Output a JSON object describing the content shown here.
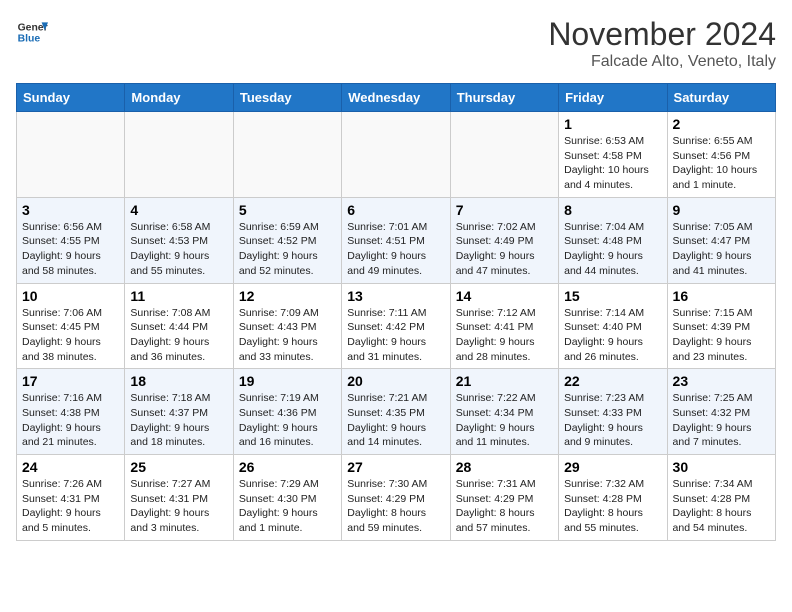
{
  "header": {
    "logo_line1": "General",
    "logo_line2": "Blue",
    "month": "November 2024",
    "location": "Falcade Alto, Veneto, Italy"
  },
  "weekdays": [
    "Sunday",
    "Monday",
    "Tuesday",
    "Wednesday",
    "Thursday",
    "Friday",
    "Saturday"
  ],
  "weeks": [
    [
      {
        "day": "",
        "info": ""
      },
      {
        "day": "",
        "info": ""
      },
      {
        "day": "",
        "info": ""
      },
      {
        "day": "",
        "info": ""
      },
      {
        "day": "",
        "info": ""
      },
      {
        "day": "1",
        "info": "Sunrise: 6:53 AM\nSunset: 4:58 PM\nDaylight: 10 hours\nand 4 minutes."
      },
      {
        "day": "2",
        "info": "Sunrise: 6:55 AM\nSunset: 4:56 PM\nDaylight: 10 hours\nand 1 minute."
      }
    ],
    [
      {
        "day": "3",
        "info": "Sunrise: 6:56 AM\nSunset: 4:55 PM\nDaylight: 9 hours\nand 58 minutes."
      },
      {
        "day": "4",
        "info": "Sunrise: 6:58 AM\nSunset: 4:53 PM\nDaylight: 9 hours\nand 55 minutes."
      },
      {
        "day": "5",
        "info": "Sunrise: 6:59 AM\nSunset: 4:52 PM\nDaylight: 9 hours\nand 52 minutes."
      },
      {
        "day": "6",
        "info": "Sunrise: 7:01 AM\nSunset: 4:51 PM\nDaylight: 9 hours\nand 49 minutes."
      },
      {
        "day": "7",
        "info": "Sunrise: 7:02 AM\nSunset: 4:49 PM\nDaylight: 9 hours\nand 47 minutes."
      },
      {
        "day": "8",
        "info": "Sunrise: 7:04 AM\nSunset: 4:48 PM\nDaylight: 9 hours\nand 44 minutes."
      },
      {
        "day": "9",
        "info": "Sunrise: 7:05 AM\nSunset: 4:47 PM\nDaylight: 9 hours\nand 41 minutes."
      }
    ],
    [
      {
        "day": "10",
        "info": "Sunrise: 7:06 AM\nSunset: 4:45 PM\nDaylight: 9 hours\nand 38 minutes."
      },
      {
        "day": "11",
        "info": "Sunrise: 7:08 AM\nSunset: 4:44 PM\nDaylight: 9 hours\nand 36 minutes."
      },
      {
        "day": "12",
        "info": "Sunrise: 7:09 AM\nSunset: 4:43 PM\nDaylight: 9 hours\nand 33 minutes."
      },
      {
        "day": "13",
        "info": "Sunrise: 7:11 AM\nSunset: 4:42 PM\nDaylight: 9 hours\nand 31 minutes."
      },
      {
        "day": "14",
        "info": "Sunrise: 7:12 AM\nSunset: 4:41 PM\nDaylight: 9 hours\nand 28 minutes."
      },
      {
        "day": "15",
        "info": "Sunrise: 7:14 AM\nSunset: 4:40 PM\nDaylight: 9 hours\nand 26 minutes."
      },
      {
        "day": "16",
        "info": "Sunrise: 7:15 AM\nSunset: 4:39 PM\nDaylight: 9 hours\nand 23 minutes."
      }
    ],
    [
      {
        "day": "17",
        "info": "Sunrise: 7:16 AM\nSunset: 4:38 PM\nDaylight: 9 hours\nand 21 minutes."
      },
      {
        "day": "18",
        "info": "Sunrise: 7:18 AM\nSunset: 4:37 PM\nDaylight: 9 hours\nand 18 minutes."
      },
      {
        "day": "19",
        "info": "Sunrise: 7:19 AM\nSunset: 4:36 PM\nDaylight: 9 hours\nand 16 minutes."
      },
      {
        "day": "20",
        "info": "Sunrise: 7:21 AM\nSunset: 4:35 PM\nDaylight: 9 hours\nand 14 minutes."
      },
      {
        "day": "21",
        "info": "Sunrise: 7:22 AM\nSunset: 4:34 PM\nDaylight: 9 hours\nand 11 minutes."
      },
      {
        "day": "22",
        "info": "Sunrise: 7:23 AM\nSunset: 4:33 PM\nDaylight: 9 hours\nand 9 minutes."
      },
      {
        "day": "23",
        "info": "Sunrise: 7:25 AM\nSunset: 4:32 PM\nDaylight: 9 hours\nand 7 minutes."
      }
    ],
    [
      {
        "day": "24",
        "info": "Sunrise: 7:26 AM\nSunset: 4:31 PM\nDaylight: 9 hours\nand 5 minutes."
      },
      {
        "day": "25",
        "info": "Sunrise: 7:27 AM\nSunset: 4:31 PM\nDaylight: 9 hours\nand 3 minutes."
      },
      {
        "day": "26",
        "info": "Sunrise: 7:29 AM\nSunset: 4:30 PM\nDaylight: 9 hours\nand 1 minute."
      },
      {
        "day": "27",
        "info": "Sunrise: 7:30 AM\nSunset: 4:29 PM\nDaylight: 8 hours\nand 59 minutes."
      },
      {
        "day": "28",
        "info": "Sunrise: 7:31 AM\nSunset: 4:29 PM\nDaylight: 8 hours\nand 57 minutes."
      },
      {
        "day": "29",
        "info": "Sunrise: 7:32 AM\nSunset: 4:28 PM\nDaylight: 8 hours\nand 55 minutes."
      },
      {
        "day": "30",
        "info": "Sunrise: 7:34 AM\nSunset: 4:28 PM\nDaylight: 8 hours\nand 54 minutes."
      }
    ]
  ]
}
